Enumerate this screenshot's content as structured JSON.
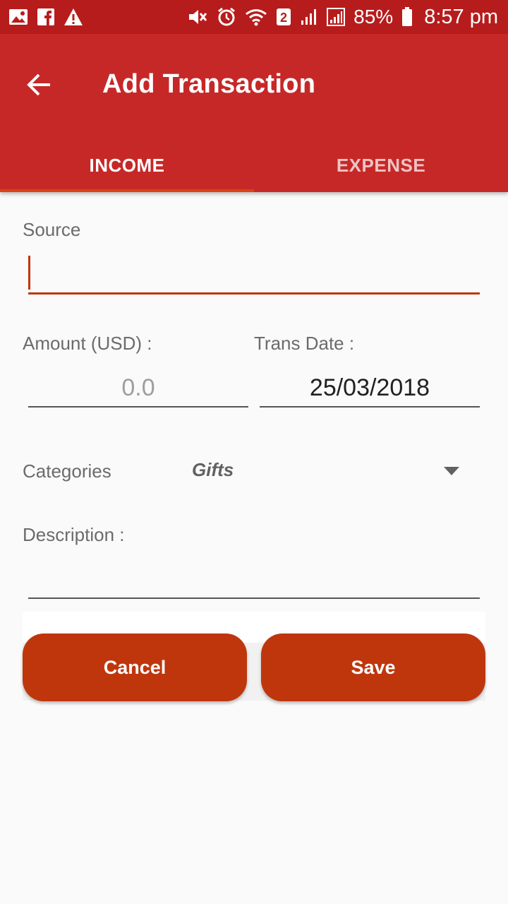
{
  "status_bar": {
    "left_icons": [
      "image-icon",
      "facebook-icon",
      "warning-icon"
    ],
    "right_icons": [
      "mute-icon",
      "alarm-icon",
      "wifi-icon",
      "sim-2-icon",
      "signal-icon",
      "signal-icon",
      "battery-icon"
    ],
    "sim_badge": "2",
    "battery": "85%",
    "time": "8:57 pm"
  },
  "app_bar": {
    "title": "Add Transaction",
    "back_icon": "arrow-left-icon",
    "background": "#c62828"
  },
  "tabs": [
    {
      "label": "INCOME",
      "active": true
    },
    {
      "label": "EXPENSE",
      "active": false
    }
  ],
  "form": {
    "source": {
      "label": "Source",
      "value": ""
    },
    "amount": {
      "label": "Amount (USD) :",
      "placeholder": "0.0",
      "value": ""
    },
    "trans_date": {
      "label": "Trans Date :",
      "value": "25/03/2018"
    },
    "categories": {
      "label": "Categories",
      "selected": "Gifts"
    },
    "description": {
      "label": "Description :",
      "value": ""
    }
  },
  "actions": {
    "cancel_label": "Cancel",
    "save_label": "Save",
    "button_color": "#bf360c"
  }
}
